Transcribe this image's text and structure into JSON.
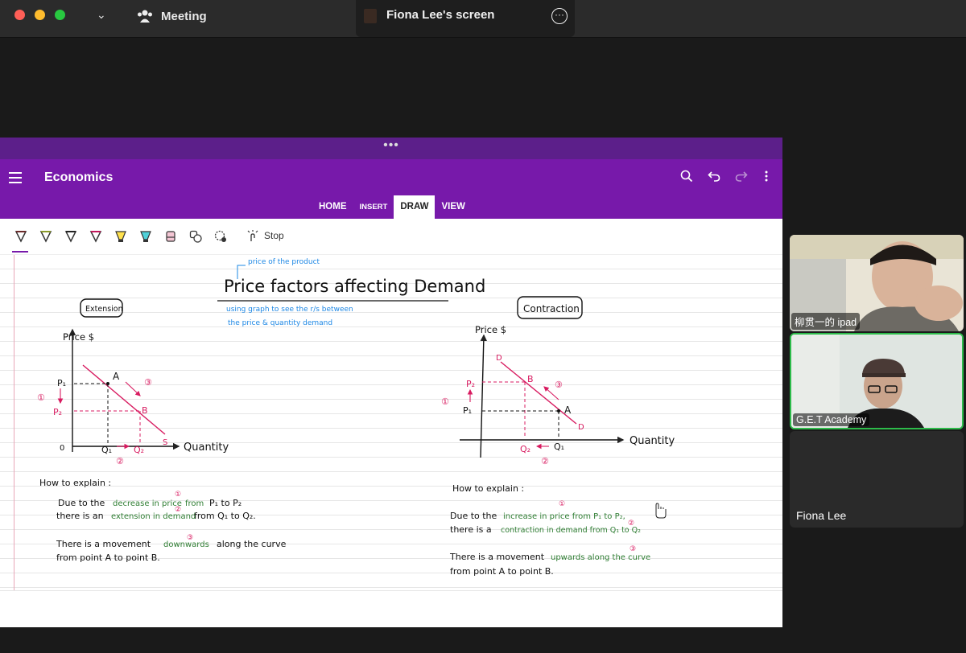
{
  "window": {
    "meeting_label": "Meeting",
    "share_title": "Fiona Lee's screen",
    "more_glyph": "···"
  },
  "app": {
    "grip_glyph": "•••",
    "notebook_title": "Economics",
    "tabs": [
      {
        "label": "HOME"
      },
      {
        "label": "INSERT"
      },
      {
        "label": "DRAW",
        "active": true
      },
      {
        "label": "VIEW"
      }
    ],
    "toolbar": {
      "stop_label": "Stop",
      "tools": [
        "pen-tool-icon",
        "pen-tool-icon",
        "pen-tool-icon",
        "pen-tool-icon",
        "highlighter-icon",
        "highlighter-icon",
        "eraser-icon",
        "shapes-icon",
        "lasso-select-icon"
      ]
    },
    "accent_color": "#7719aa"
  },
  "notes": {
    "title": "Price factors affecting Demand",
    "annot_top": "price of the product",
    "annot_line1": "using graph to see the r/s between",
    "annot_line2": "the price & quantity demand",
    "left": {
      "label": "Extension",
      "price_axis": "Price $",
      "qty_axis": "Quantity",
      "origin": "0",
      "p1": "P₁",
      "p2": "P₂",
      "q1": "Q₁",
      "q2": "Q₂",
      "pt_a": "A",
      "pt_b": "B",
      "pt_s": "S",
      "step1": "①",
      "step2": "②",
      "step3": "③",
      "how_title": "How to explain :",
      "line1_a": "Due to the",
      "line1_b": "decrease in price",
      "line1_c": "from",
      "line1_d": "P₁ to P₂",
      "line2_a": "there is an",
      "line2_b": "extension in demand",
      "line2_c": "from Q₁ to Q₂.",
      "line3_a": "There is a movement",
      "line3_b": "downwards",
      "line3_c": "along the curve",
      "line4": "from point A to point B."
    },
    "right": {
      "label": "Contraction",
      "price_axis": "Price $",
      "qty_axis": "Quantity",
      "p1": "P₁",
      "p2": "P₂",
      "q1": "Q₁",
      "q2": "Q₂",
      "pt_a": "A",
      "pt_b": "B",
      "pt_d1": "D",
      "pt_d2": "D",
      "step1": "①",
      "step2": "②",
      "step3": "③",
      "how_title": "How to explain :",
      "line1_a": "Due to the",
      "line1_b": "increase in price from P₁ to P₂,",
      "line2_a": "there is a",
      "line2_b": "contraction in demand from Q₁ to Q₂",
      "line3_a": "There is a movement",
      "line3_b": "upwards along the curve",
      "line4": "from point A to point B."
    }
  },
  "participants": [
    {
      "name": "柳贯一的 ipad"
    },
    {
      "name": "G.E.T Academy"
    },
    {
      "name": "Fiona Lee"
    }
  ]
}
